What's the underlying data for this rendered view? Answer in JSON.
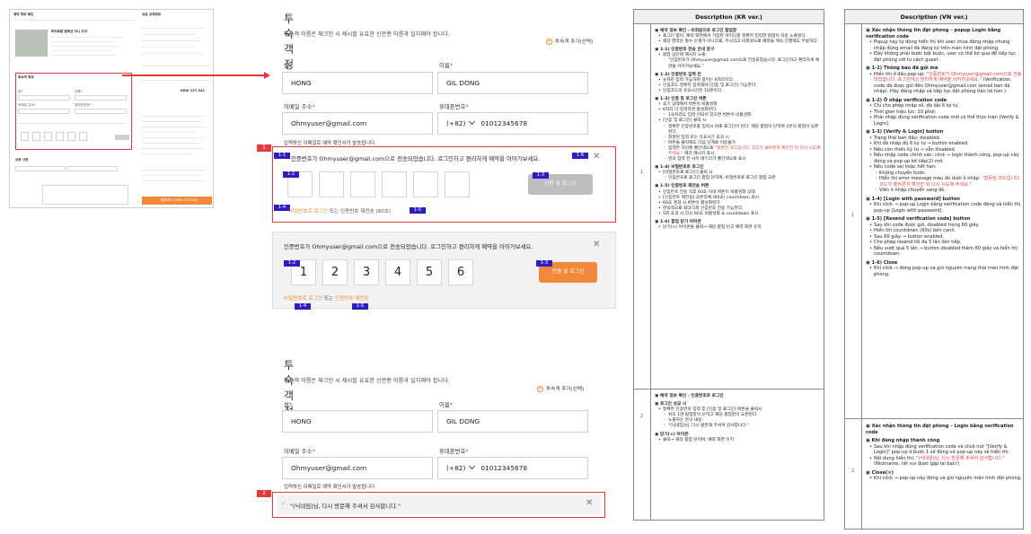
{
  "thumbnail": {
    "lines": [
      "예약 정보 확인",
      "요금 상세정보",
      "파크로얄 컬렉션 미니 도어",
      "투숙객 정보",
      "성*",
      "이름*",
      "이메일 주소*",
      "휴대폰번호*",
      "요청 사항",
      "결제하기 (KRW 137,341)"
    ],
    "price_total": "KRW 137,341"
  },
  "mock1": {
    "title": "투숙객 정보",
    "subtitle": "투숙객 이름은 체크인 시 제시할 유효한 신분증 이름과 일치해야 합니다.",
    "add_guest": "투숙객 추가(선택)",
    "last_name_label": "성",
    "first_name_label": "이름",
    "last_name": "HONG",
    "first_name": "GIL DONG",
    "email_label": "이메일 주소",
    "phone_label": "휴대폰번호",
    "email": "Ohmyuser@gmail.com",
    "country_code": "(+82)",
    "phone": "01012345678",
    "note": "입력하신 이메일로 예약 확인서가 발송됩니다.",
    "popup_msg": "인증번호가 Ohmyuser@gmail.com으로 전송되었습니다. 로그인하고 편리하게 예약을 이어가보세요.",
    "verify_btn": "인증 및 로그인",
    "pw_login": "비밀번호로 로그인",
    "or_text": "또는",
    "resend": "인증번호 재전송 (60초)",
    "marker": "1"
  },
  "tags": {
    "t1_1": "1-1",
    "t1_2": "1-2",
    "t1_3": "1-3",
    "t1_4": "1-4",
    "t1_5": "1-5",
    "t1_6": "1-6"
  },
  "mock2": {
    "popup_msg": "인증번호가 Ohmyuser@gmail.com으로 전송되었습니다. 로그인하고 편리하게 예약을 이어가보세요.",
    "digits": [
      "1",
      "2",
      "3",
      "4",
      "5",
      "6"
    ],
    "verify_btn": "인증 및 로그인",
    "pw_login": "비밀번호로 로그인",
    "or_text": "또는",
    "resend": "인증번호 재전송"
  },
  "mock3": {
    "title": "투숙객 정보",
    "subtitle": "투숙객 이름은 체크인 시 제시할 유효한 신분증 이름과 일치해야 합니다.",
    "add_guest": "투숙객 추가(선택)",
    "last_name_label": "성",
    "first_name_label": "이름",
    "last_name": "HONG",
    "first_name": "GIL DONG",
    "email_label": "이메일 주소",
    "phone_label": "휴대폰번호",
    "email": "Ohmyuser@gmail.com",
    "country_code": "(+82)",
    "phone": "01012345678",
    "note": "입력하신 이메일로 예약 확인서가 발송됩니다.",
    "toast": "\"(닉네임)님, 다시 방문해 주셔서 감사합니다.\"",
    "marker": "2"
  },
  "kr_table": {
    "header": "Description (KR ver.)",
    "row1_num": "1",
    "row2_num": "2"
  },
  "vn_table": {
    "header": "Description (VN ver.)",
    "row1_num": "1",
    "row2_num": "2"
  }
}
